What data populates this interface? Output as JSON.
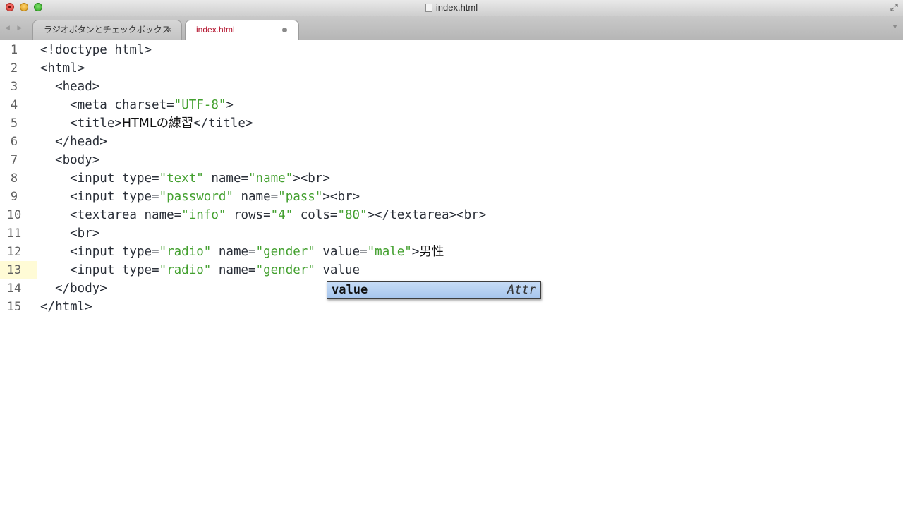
{
  "window": {
    "title": "index.html"
  },
  "tabs": [
    {
      "label": "ラジオボタンとチェックボックス",
      "close": "×",
      "active": false
    },
    {
      "label": "index.html",
      "active": true,
      "modified": true
    }
  ],
  "editor": {
    "current_line": 13,
    "lines": [
      {
        "num": "1",
        "code": "<!doctype html>"
      },
      {
        "num": "2",
        "code": "<html>"
      },
      {
        "num": "3",
        "code": "  <head>"
      },
      {
        "num": "4",
        "code": "    <meta charset=\"UTF-8\">"
      },
      {
        "num": "5",
        "code": "    <title>HTMLの練習</title>"
      },
      {
        "num": "6",
        "code": "  </head>"
      },
      {
        "num": "7",
        "code": "  <body>"
      },
      {
        "num": "8",
        "code": "    <input type=\"text\" name=\"name\"><br>"
      },
      {
        "num": "9",
        "code": "    <input type=\"password\" name=\"pass\"><br>"
      },
      {
        "num": "10",
        "code": "    <textarea name=\"info\" rows=\"4\" cols=\"80\"></textarea><br>"
      },
      {
        "num": "11",
        "code": "    <br>"
      },
      {
        "num": "12",
        "code": "    <input type=\"radio\" name=\"gender\" value=\"male\">男性"
      },
      {
        "num": "13",
        "code": "    <input type=\"radio\" name=\"gender\" value"
      },
      {
        "num": "14",
        "code": "  </body>"
      },
      {
        "num": "15",
        "code": "</html>"
      }
    ]
  },
  "autocomplete": {
    "word": "value",
    "kind": "Attr"
  },
  "colors": {
    "string": "#43a02f",
    "tag": "#2a2f38",
    "active_tab_text": "#b3112b",
    "current_line_gutter": "#fffbd6"
  }
}
